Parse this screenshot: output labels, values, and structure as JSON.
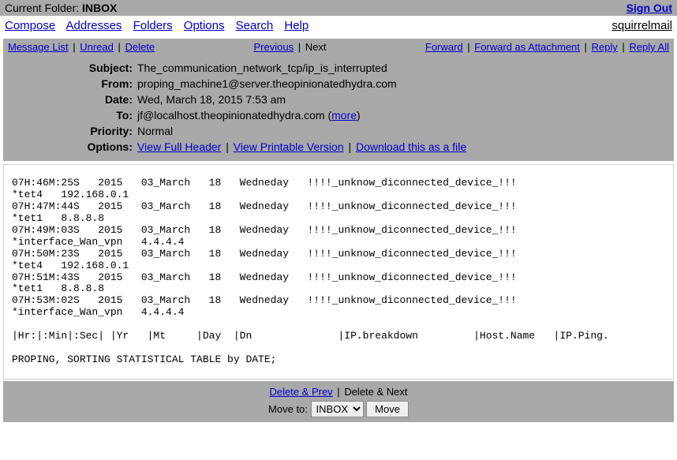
{
  "top": {
    "currentFolderLabel": "Current Folder:",
    "currentFolder": "INBOX",
    "signout": "Sign Out"
  },
  "nav": {
    "compose": "Compose",
    "addresses": "Addresses",
    "folders": "Folders",
    "options": "Options",
    "search": "Search",
    "help": "Help",
    "brand": "squirrelmail"
  },
  "actions": {
    "messageList": "Message List",
    "unread": "Unread",
    "delete": "Delete",
    "previous": "Previous",
    "next": "Next",
    "forward": "Forward",
    "forwardAttachment": "Forward as Attachment",
    "reply": "Reply",
    "replyAll": "Reply All"
  },
  "headers": {
    "subjectLabel": "Subject:",
    "subject": "The_communication_network_tcp/ip_is_interrupted",
    "fromLabel": "From:",
    "from": "proping_machine1@server.theopinionatedhydra.com",
    "dateLabel": "Date:",
    "date": "Wed, March 18, 2015 7:53 am",
    "toLabel": "To:",
    "toPrefix": "jf@localhost.theopinionatedhydra.com (",
    "toMore": "more",
    "toSuffix": ")",
    "priorityLabel": "Priority:",
    "priority": "Normal",
    "optionsLabel": "Options:",
    "viewFullHeader": "View Full Header",
    "viewPrintable": "View Printable Version",
    "download": "Download this as a file"
  },
  "body": "07H:46M:25S   2015   03_March   18   Wedneday   !!!!_unknow_diconnected_device_!!!\n*tet4   192.168.0.1\n07H:47M:44S   2015   03_March   18   Wedneday   !!!!_unknow_diconnected_device_!!!\n*tet1   8.8.8.8\n07H:49M:03S   2015   03_March   18   Wedneday   !!!!_unknow_diconnected_device_!!!\n*interface_Wan_vpn   4.4.4.4\n07H:50M:23S   2015   03_March   18   Wedneday   !!!!_unknow_diconnected_device_!!!\n*tet4   192.168.0.1\n07H:51M:43S   2015   03_March   18   Wedneday   !!!!_unknow_diconnected_device_!!!\n*tet1   8.8.8.8\n07H:53M:02S   2015   03_March   18   Wedneday   !!!!_unknow_diconnected_device_!!!\n*interface_Wan_vpn   4.4.4.4\n\n|Hr:|:Min|:Sec| |Yr   |Mt     |Day  |Dn              |IP.breakdown         |Host.Name   |IP.Ping.\n\nPROPING, SORTING STATISTICAL TABLE by DATE;",
  "bottom": {
    "deletePrev": "Delete & Prev",
    "deleteNext": "Delete & Next",
    "moveTo": "Move to:",
    "selected": "INBOX",
    "moveBtn": "Move"
  }
}
